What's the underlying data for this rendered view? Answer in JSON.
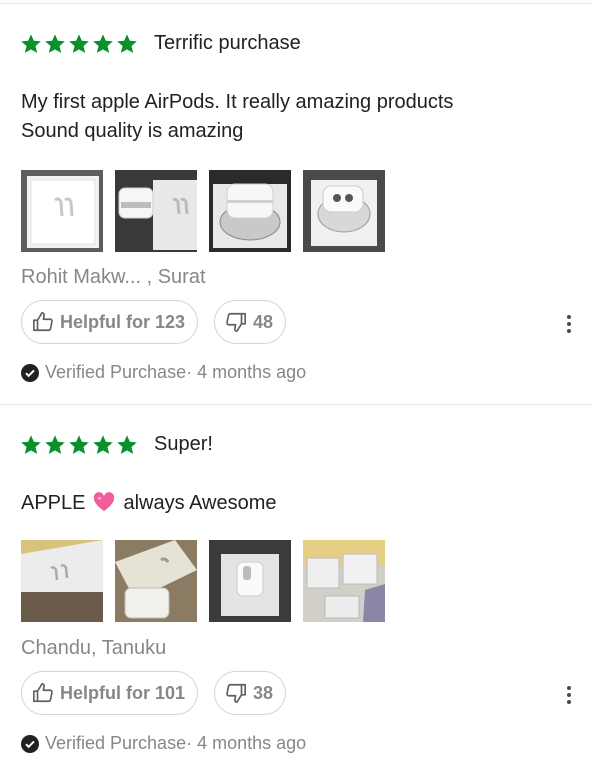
{
  "reviews": [
    {
      "rating": 5,
      "title": "Terrific purchase",
      "body": "My first apple AirPods. It really amazing products\nSound quality is amazing",
      "photos": [
        "box-front",
        "case-and-box",
        "case-in-tray",
        "open-case-in-tray"
      ],
      "reviewer": "Rohit Makw...  , Surat",
      "helpful_label": "Helpful for 123",
      "dislike_count": "48",
      "verified_label": "Verified Purchase",
      "time_label": "· 4 months ago"
    },
    {
      "rating": 5,
      "title": "Super!",
      "body_prefix": "APPLE",
      "body_emoji": "pink-heart-icon",
      "body_suffix": "always Awesome",
      "photos": [
        "box-closeup",
        "earbuds-and-box",
        "case-closeup",
        "accessories"
      ],
      "reviewer": "Chandu, Tanuku",
      "helpful_label": "Helpful for 101",
      "dislike_count": "38",
      "verified_label": "Verified Purchase",
      "time_label": "· 4 months ago"
    }
  ],
  "colors": {
    "star": "#098f2c",
    "muted_text": "#878787",
    "border": "#d4d4d4",
    "heart": "#f25c9a"
  }
}
